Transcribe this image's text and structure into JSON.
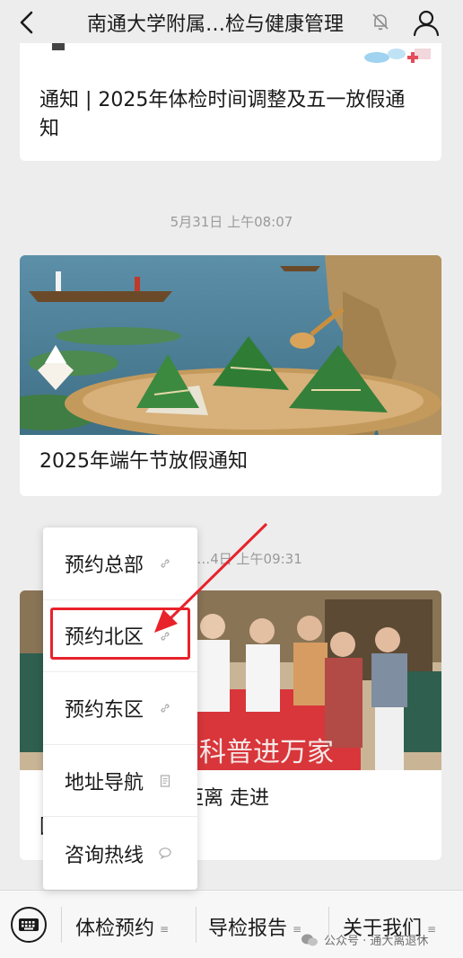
{
  "header": {
    "title": "南通大学附属…检与健康管理"
  },
  "articles": [
    {
      "title": "通知 | 2025年体检时间调整及五一放假通知"
    },
    {
      "title": "2025年端午节放假通知"
    },
    {
      "title": "【…】健康服务零距离 走进…团",
      "title_line1": "【           】健康服务零距离 走进",
      "title_line2": "            团",
      "banner_text": "科普进万家"
    }
  ],
  "timestamps": {
    "t1": "5月31日 上午08:07",
    "t2": "…4日 上午09:31"
  },
  "popup_menu": {
    "items": [
      {
        "label": "预约总部",
        "icon": "link-icon"
      },
      {
        "label": "预约北区",
        "icon": "link-icon",
        "highlighted": true
      },
      {
        "label": "预约东区",
        "icon": "link-icon"
      },
      {
        "label": "地址导航",
        "icon": "article-icon"
      },
      {
        "label": "咨询热线",
        "icon": "chat-bubble-icon"
      }
    ]
  },
  "bottom_menu": {
    "tabs": [
      {
        "label": "体检预约"
      },
      {
        "label": "导检报告"
      },
      {
        "label": "关于我们"
      }
    ]
  },
  "watermark": "公众号 · 通大离退休",
  "colors": {
    "highlight": "#e8222b",
    "background": "#ededed"
  }
}
